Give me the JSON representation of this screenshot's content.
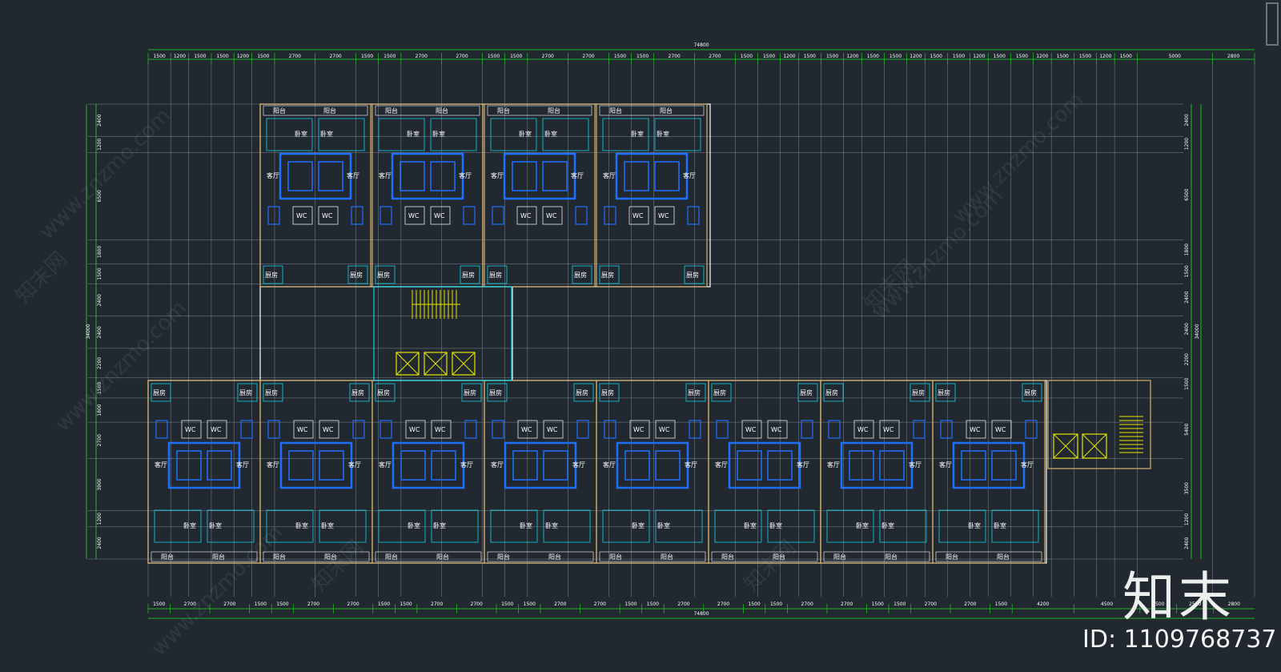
{
  "drawing": {
    "overall_dimension": "74800",
    "top_segments": [
      "1500",
      "1200",
      "1500",
      "1500",
      "1200",
      "1500",
      "2700",
      "2700",
      "1500",
      "1500",
      "2700",
      "2700",
      "1500",
      "1500",
      "2700",
      "2700",
      "1500",
      "1500",
      "2700",
      "2700",
      "1500",
      "1500",
      "1200",
      "1500",
      "1500",
      "1200",
      "1500",
      "1500",
      "1200",
      "1500",
      "1500",
      "1200",
      "1500",
      "1500",
      "1200",
      "1500",
      "1500",
      "1200",
      "1500",
      "5000",
      "2800"
    ],
    "bottom_segments": [
      "1500",
      "2700",
      "2700",
      "1500",
      "1500",
      "2700",
      "2700",
      "1500",
      "1500",
      "2700",
      "2700",
      "1500",
      "1500",
      "2700",
      "2700",
      "1500",
      "1500",
      "2700",
      "2700",
      "1500",
      "1500",
      "2700",
      "2700",
      "1500",
      "1500",
      "2700",
      "2700",
      "1500",
      "4200",
      "4500",
      "2500",
      "2500",
      "2800"
    ],
    "left_segments": [
      "2400",
      "1200",
      "6500",
      "1800",
      "1500",
      "2400",
      "2400",
      "2200",
      "1500",
      "1800",
      "2700",
      "3900",
      "1200",
      "2400"
    ],
    "left_total": "34000",
    "right_segments": [
      "2400",
      "1200",
      "6500",
      "1800",
      "1500",
      "2400",
      "2400",
      "2200",
      "1500",
      "5400",
      "3500",
      "1200",
      "2400"
    ],
    "right_total": "34000",
    "room_labels": {
      "balcony": "阳台",
      "bedroom": "卧室",
      "living": "客厅",
      "kitchen": "厨房",
      "wc": "WC"
    }
  },
  "watermark": {
    "site": "www.znzmo.com",
    "cn": "知末网"
  },
  "brand": {
    "logo_text": "知末",
    "id_text": "ID: 1109768737"
  },
  "colors": {
    "background": "#212830",
    "grid": "#cfd5dc",
    "dimension": "#22dd22",
    "wall": "#c8a86a",
    "furniture": "#1f6fff",
    "fixture": "#14d2e6",
    "stair": "#e6e600"
  }
}
